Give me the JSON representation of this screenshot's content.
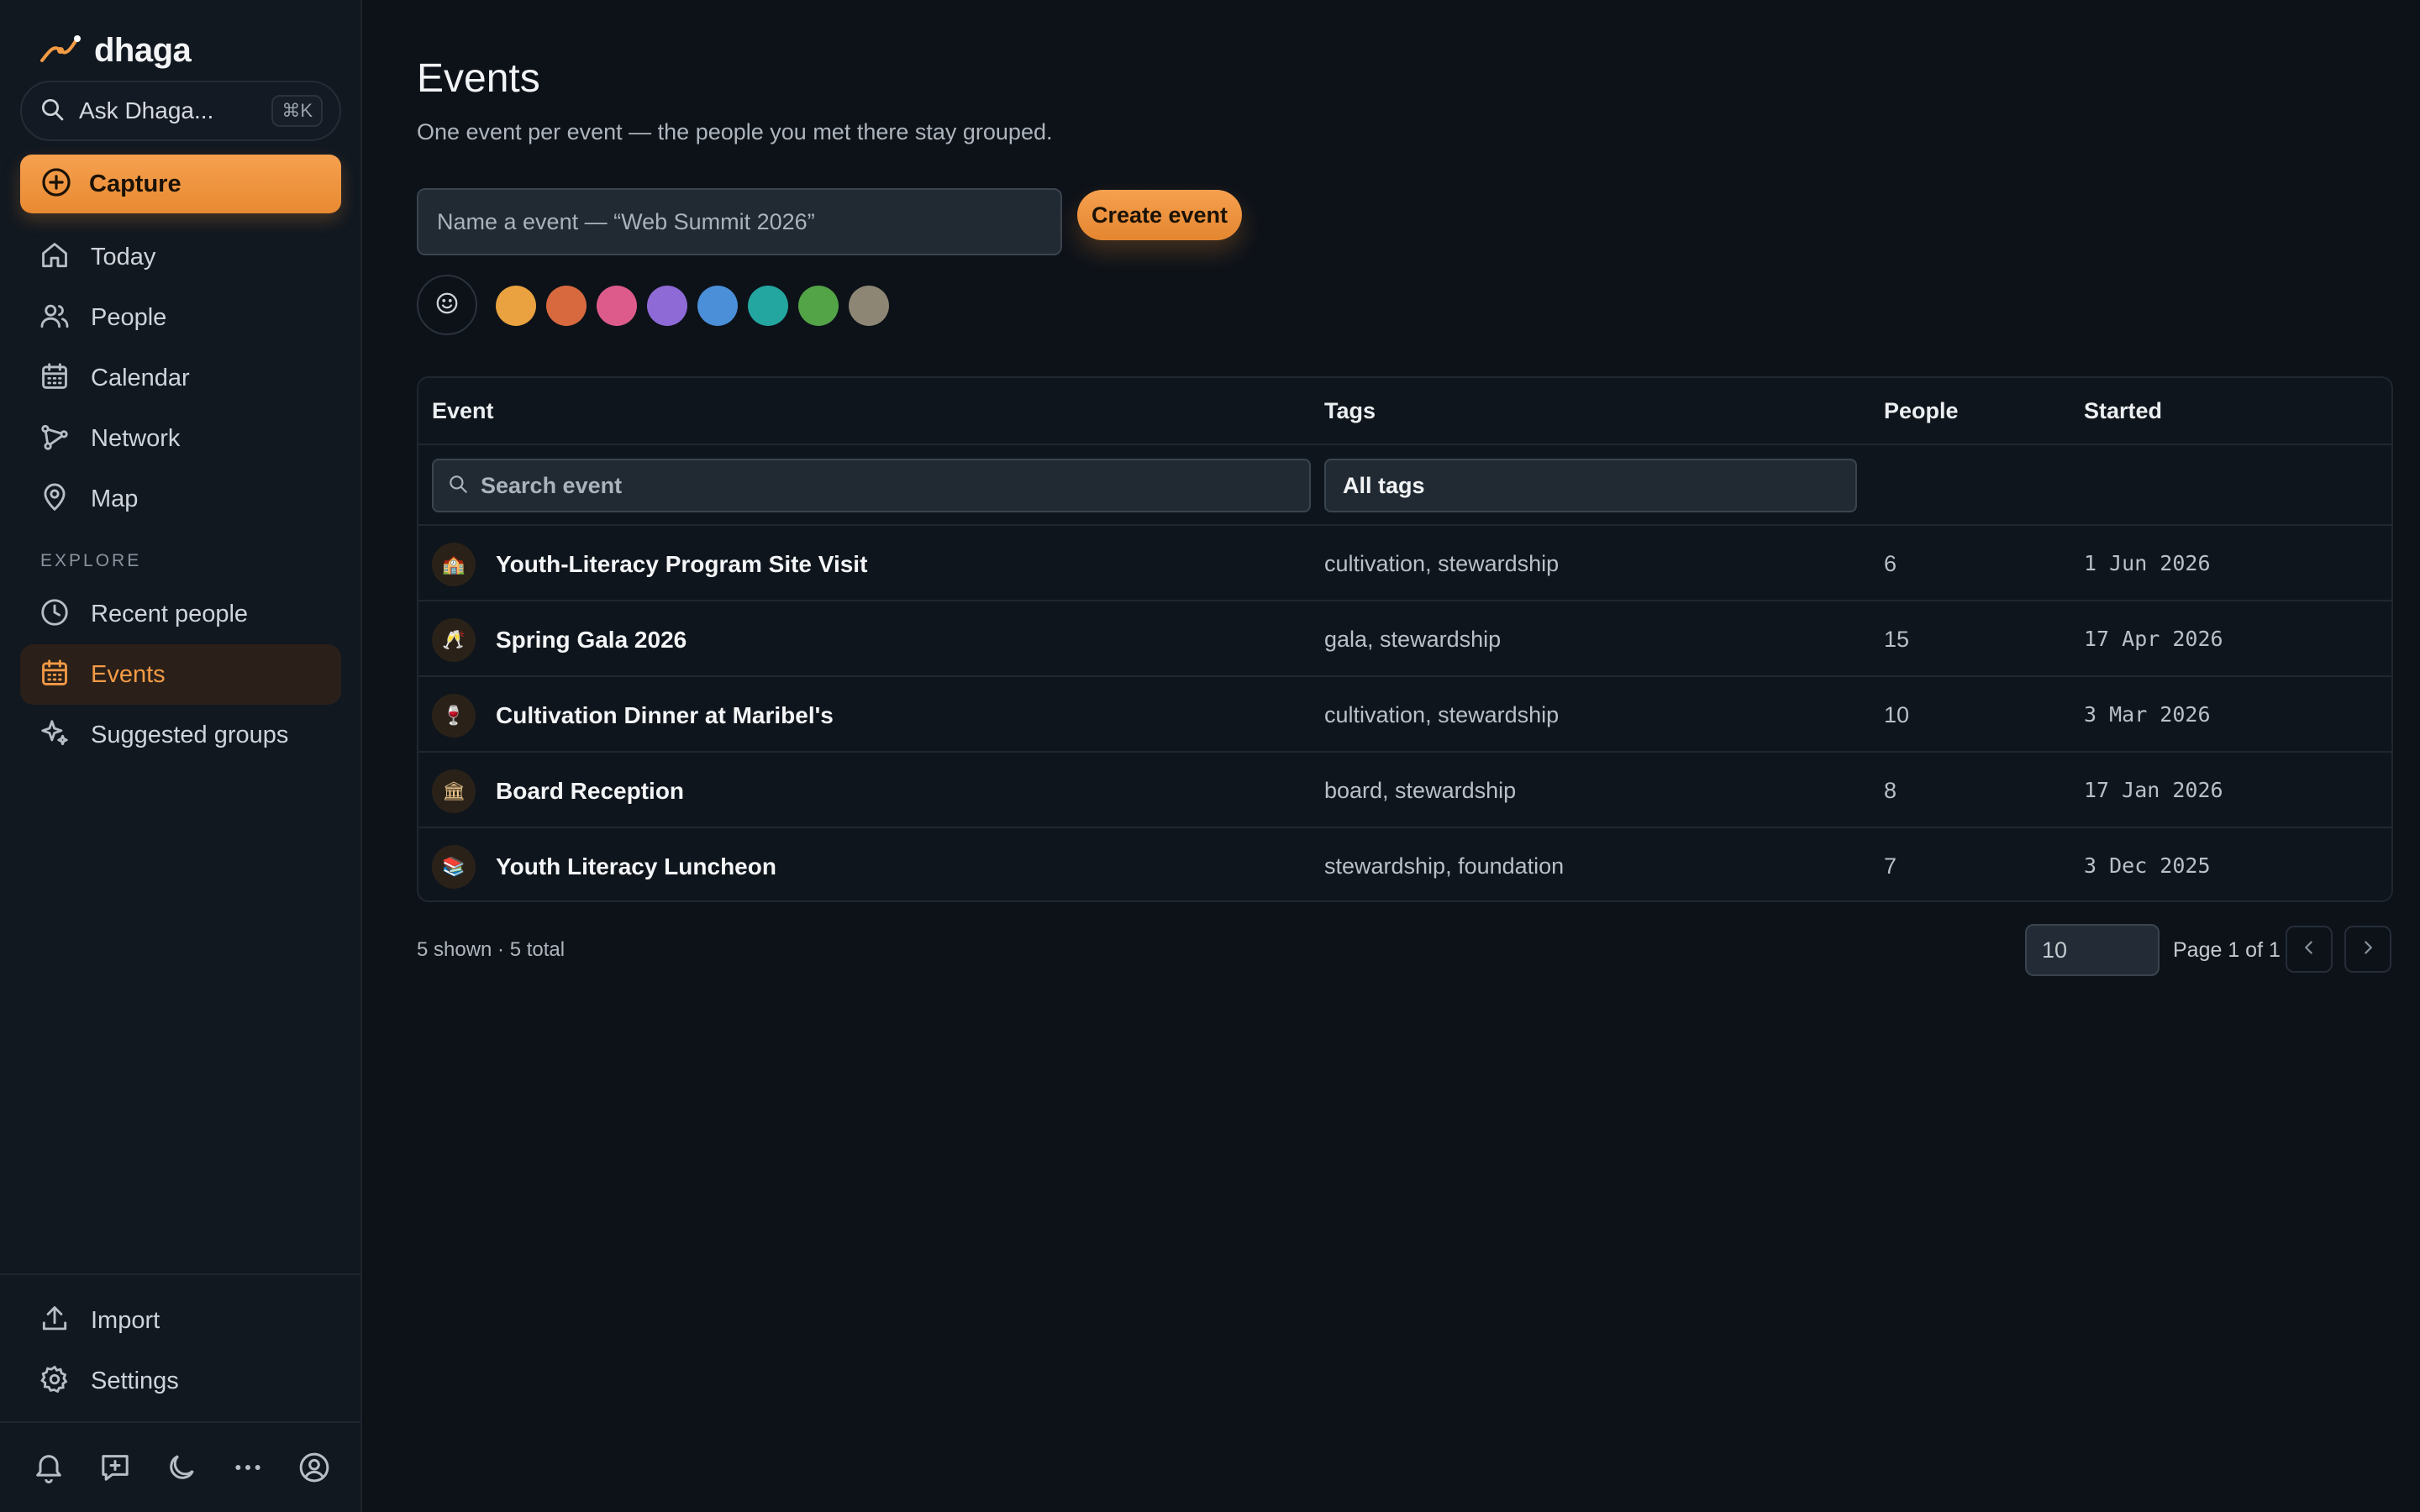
{
  "brand": {
    "name": "dhaga"
  },
  "ask": {
    "label": "Ask Dhaga...",
    "shortcut": "⌘K"
  },
  "capture": {
    "label": "Capture"
  },
  "nav": [
    {
      "label": "Today",
      "icon": "home-icon"
    },
    {
      "label": "People",
      "icon": "users-icon"
    },
    {
      "label": "Calendar",
      "icon": "calendar-icon"
    },
    {
      "label": "Network",
      "icon": "network-icon"
    },
    {
      "label": "Map",
      "icon": "map-pin-icon"
    }
  ],
  "explore": {
    "label": "EXPLORE",
    "items": [
      {
        "label": "Recent people",
        "icon": "clock-icon"
      },
      {
        "label": "Events",
        "icon": "calendar-icon",
        "active": true
      },
      {
        "label": "Suggested groups",
        "icon": "sparkles-icon"
      }
    ]
  },
  "bottom_nav": [
    {
      "label": "Import",
      "icon": "upload-icon"
    },
    {
      "label": "Settings",
      "icon": "gear-icon"
    }
  ],
  "footer_icons": [
    "bell-icon",
    "message-plus-icon",
    "moon-icon",
    "more-icon",
    "profile-icon"
  ],
  "page": {
    "title": "Events",
    "subtitle": "One event per event — the people you met there stay grouped.",
    "name_placeholder": "Name a event — “Web Summit 2026”",
    "create_label": "Create event",
    "swatches": [
      "#e9a23f",
      "#d8693f",
      "#dd5b8a",
      "#8e6ad6",
      "#4a8fd8",
      "#23a6a0",
      "#53a347",
      "#8d8674"
    ]
  },
  "table": {
    "headers": {
      "event": "Event",
      "tags": "Tags",
      "people": "People",
      "started": "Started"
    },
    "search_placeholder": "Search event",
    "tags_filter": "All tags",
    "rows": [
      {
        "icon": "🏫",
        "name": "Youth-Literacy Program Site Visit",
        "tags": "cultivation, stewardship",
        "people": "6",
        "started": "1 Jun 2026"
      },
      {
        "icon": "🥂",
        "name": "Spring Gala 2026",
        "tags": "gala, stewardship",
        "people": "15",
        "started": "17 Apr 2026"
      },
      {
        "icon": "🍷",
        "name": "Cultivation Dinner at Maribel's",
        "tags": "cultivation, stewardship",
        "people": "10",
        "started": "3 Mar 2026"
      },
      {
        "icon": "🏛",
        "name": "Board Reception",
        "tags": "board, stewardship",
        "people": "8",
        "started": "17 Jan 2026"
      },
      {
        "icon": "📚",
        "name": "Youth Literacy Luncheon",
        "tags": "stewardship, foundation",
        "people": "7",
        "started": "3 Dec 2025"
      }
    ]
  },
  "pagination": {
    "count": "5 shown · 5 total",
    "page_size": "10",
    "page_info": "Page 1 of 1"
  }
}
